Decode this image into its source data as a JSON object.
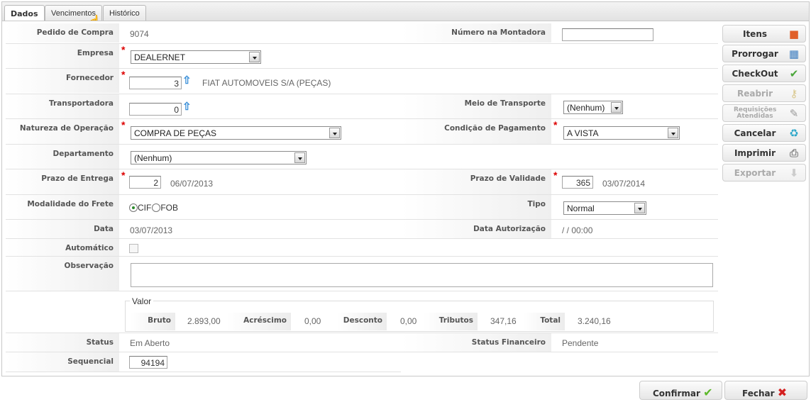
{
  "tabs": [
    {
      "label": "Dados",
      "active": true
    },
    {
      "label": "Vencimentos"
    },
    {
      "label": "Histórico"
    }
  ],
  "form": {
    "pedido_label": "Pedido de Compra",
    "pedido_value": "9074",
    "numero_montadora_label": "Número na Montadora",
    "numero_montadora_value": "",
    "empresa_label": "Empresa",
    "empresa_value": "DEALERNET",
    "fornecedor_label": "Fornecedor",
    "fornecedor_code": "3",
    "fornecedor_name": "FIAT AUTOMOVEIS S/A (PEÇAS)",
    "transportadora_label": "Transportadora",
    "transportadora_code": "0",
    "meio_transporte_label": "Meio de Transporte",
    "meio_transporte_value": "(Nenhum)",
    "natureza_label": "Natureza de Operação",
    "natureza_value": "COMPRA DE PEÇAS",
    "condicao_label": "Condição de Pagamento",
    "condicao_value": "A VISTA",
    "departamento_label": "Departamento",
    "departamento_value": "(Nenhum)",
    "prazo_entrega_label": "Prazo de Entrega",
    "prazo_entrega_value": "2",
    "prazo_entrega_date": "06/07/2013",
    "prazo_validade_label": "Prazo de Validade",
    "prazo_validade_value": "365",
    "prazo_validade_date": "03/07/2014",
    "modalidade_label": "Modalidade do Frete",
    "modalidade_options": [
      "CIF",
      "FOB"
    ],
    "modalidade_selected": "CIF",
    "tipo_label": "Tipo",
    "tipo_value": "Normal",
    "data_label": "Data",
    "data_value": "03/07/2013",
    "data_autorizacao_label": "Data Autorização",
    "data_autorizacao_value": "/ / 00:00",
    "automatico_label": "Automático",
    "automatico_checked": false,
    "observacao_label": "Observação",
    "observacao_value": "",
    "valor": {
      "legend": "Valor",
      "bruto_label": "Bruto",
      "bruto": "2.893,00",
      "acrescimo_label": "Acréscimo",
      "acrescimo": "0,00",
      "desconto_label": "Desconto",
      "desconto": "0,00",
      "tributos_label": "Tributos",
      "tributos": "347,16",
      "total_label": "Total",
      "total": "3.240,16"
    },
    "status_label": "Status",
    "status_value": "Em Aberto",
    "status_fin_label": "Status Financeiro",
    "status_fin_value": "Pendente",
    "sequencial_label": "Sequencial",
    "sequencial_value": "94194",
    "required_mark": "*"
  },
  "side_buttons": [
    {
      "label": "Itens",
      "icon": "cubes-icon",
      "enabled": true
    },
    {
      "label": "Prorrogar",
      "icon": "calendar-icon",
      "enabled": true
    },
    {
      "label": "CheckOut",
      "icon": "cart-check-icon",
      "enabled": true
    },
    {
      "label": "Reabrir",
      "icon": "keys-icon",
      "enabled": false
    },
    {
      "label": "Requisições Atendidas",
      "icon": "document-edit-icon",
      "enabled": false
    },
    {
      "label": "Cancelar",
      "icon": "trash-icon",
      "enabled": true
    },
    {
      "label": "Imprimir",
      "icon": "printer-icon",
      "enabled": true
    },
    {
      "label": "Exportar",
      "icon": "arrow-down-icon",
      "enabled": false
    }
  ],
  "footer": {
    "confirm_label": "Confirmar",
    "close_label": "Fechar"
  },
  "colors": {
    "required": "#dd0000",
    "confirm": "#5cb82a",
    "close": "#d42020",
    "link_arrow": "#3a8fd8"
  }
}
